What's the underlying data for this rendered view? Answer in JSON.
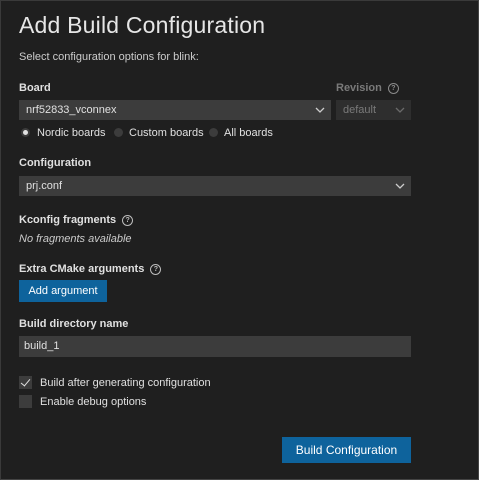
{
  "title": "Add Build Configuration",
  "subtitle": "Select configuration options for blink:",
  "board": {
    "label": "Board",
    "value": "nrf52833_vconnex",
    "options": [
      {
        "label": "Nordic boards",
        "checked": true
      },
      {
        "label": "Custom boards",
        "checked": false
      },
      {
        "label": "All boards",
        "checked": false
      }
    ]
  },
  "revision": {
    "label": "Revision",
    "value": "default",
    "help_icon": "?"
  },
  "configuration": {
    "label": "Configuration",
    "value": "prj.conf"
  },
  "kconfig": {
    "label": "Kconfig fragments",
    "help_icon": "?",
    "empty_text": "No fragments available"
  },
  "cmake": {
    "label": "Extra CMake arguments",
    "help_icon": "?",
    "add_button": "Add argument"
  },
  "build_dir": {
    "label": "Build directory name",
    "value": "build_1"
  },
  "checkboxes": [
    {
      "label": "Build after generating configuration",
      "checked": true
    },
    {
      "label": "Enable debug options",
      "checked": false
    }
  ],
  "submit_button": "Build Configuration",
  "colors": {
    "accent": "#0e639c",
    "background": "#1f1f1f",
    "input": "#3c3c3c"
  }
}
